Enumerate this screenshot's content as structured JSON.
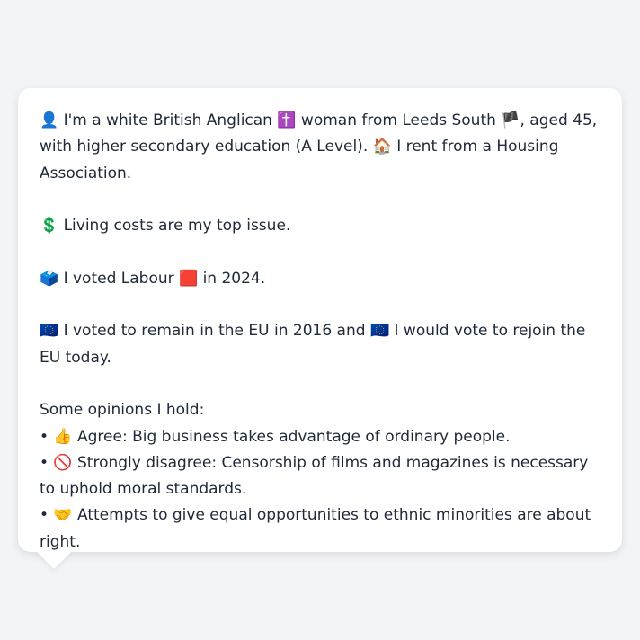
{
  "profile": {
    "identity": "👤 I'm a white British Anglican ✝️ woman from Leeds South 🏴, aged 45, with higher secondary education (A Level). 🏠 I rent from a Housing Association.",
    "top_issue": "💲 Living costs are my top issue.",
    "vote_2024": "🗳️ I voted Labour 🟥 in 2024.",
    "eu_stance": "🇪🇺 I voted to remain in the EU in 2016 and 🇪🇺 I would vote to rejoin the EU today.",
    "opinions_heading": "Some opinions I hold:",
    "opinions": [
      "• 👍 Agree: Big business takes advantage of ordinary people.",
      "• 🚫 Strongly disagree: Censorship of films and magazines is necessary to uphold moral standards.",
      "• 🤝 Attempts to give equal opportunities to ethnic minorities are about right."
    ]
  },
  "colors": {
    "page_background": "#f3f4f6",
    "card_background": "#ffffff",
    "text": "#1f2937"
  }
}
